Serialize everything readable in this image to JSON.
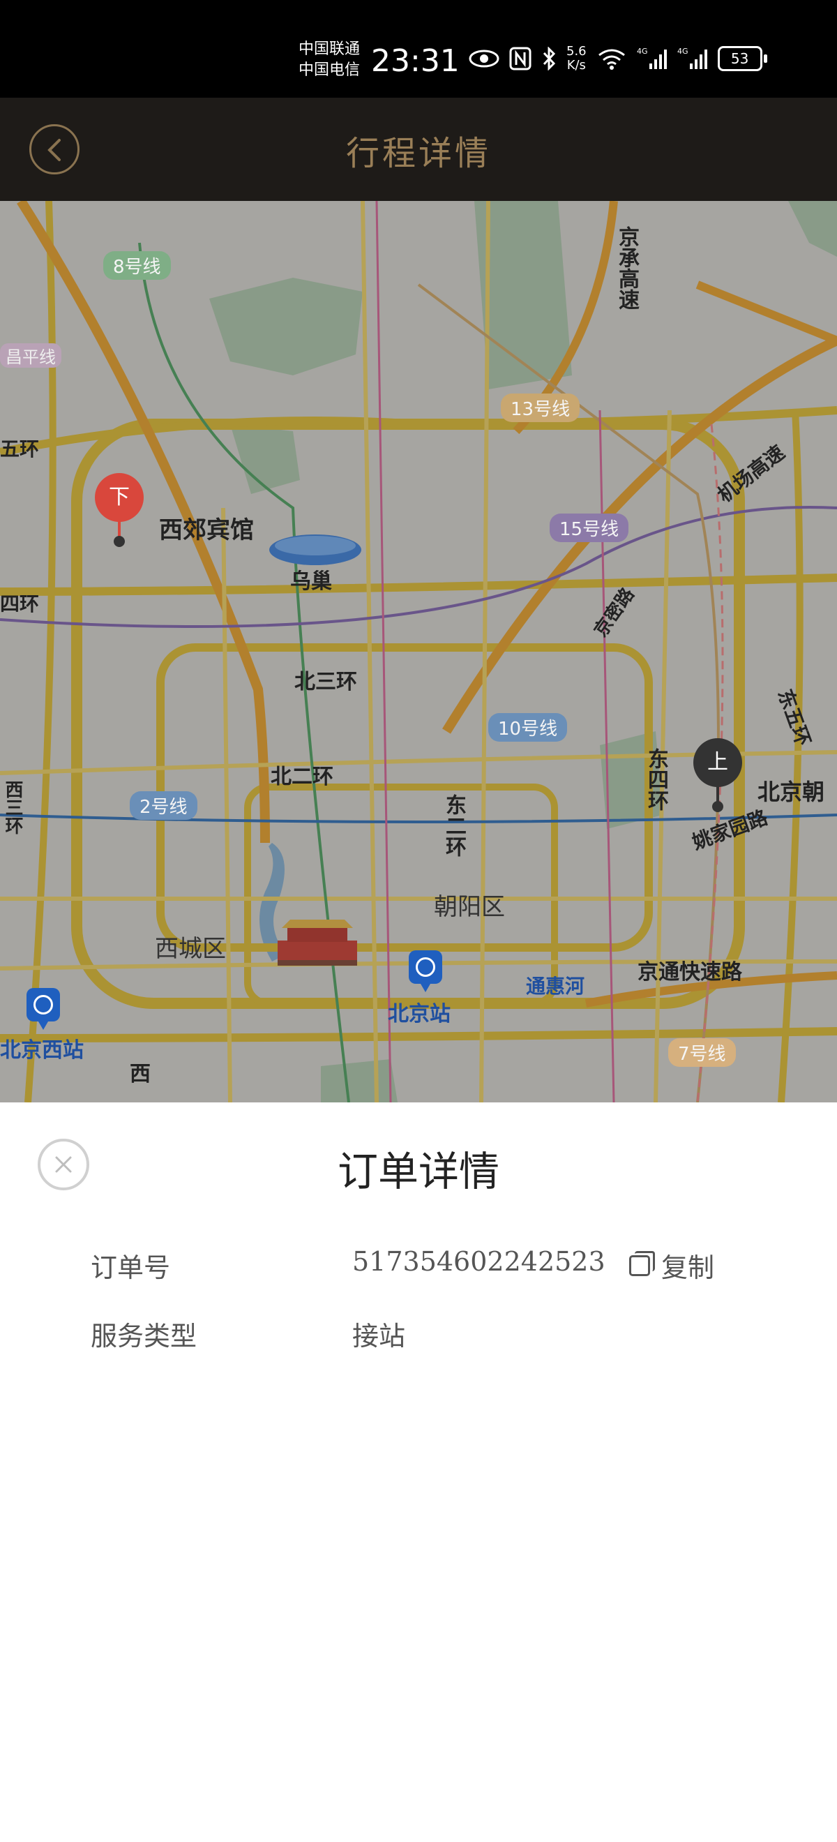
{
  "status_bar": {
    "carrier_1": "中国联通",
    "carrier_2": "中国电信",
    "time": "23:31",
    "net_speed": "5.6",
    "net_speed_unit": "K/s",
    "battery": "53"
  },
  "header": {
    "title": "行程详情"
  },
  "map": {
    "labels": {
      "xijiao": "西郊宾馆",
      "niaochao": "乌巢",
      "bei3": "北三环",
      "bei2": "北二环",
      "xicheng": "西城区",
      "chaoyang": "朝阳区",
      "beijing_station": "北京站",
      "beijingxi_station": "北京西站",
      "tonghui": "通惠河",
      "jingtong": "京通快速路",
      "yaojiayuan": "姚家园路",
      "jichang": "机场高速",
      "beijingchao": "北京朝",
      "changping": "昌平线",
      "wuhuan": "五环",
      "sihuan": "四环",
      "jingcheng": "京承高速",
      "jingmi": "京密路",
      "dong4": "东四环",
      "dong2": "东二环",
      "dong5": "东五环",
      "xi": "西",
      "xi3": "西三环"
    },
    "lines": {
      "l8": "8号线",
      "l13": "13号线",
      "l15": "15号线",
      "l10": "10号线",
      "l2": "2号线",
      "l7": "7号线"
    },
    "markers": {
      "dropoff": "下",
      "pickup": "上"
    }
  },
  "sheet": {
    "title": "订单详情",
    "order_label": "订单号",
    "order_value": "517354602242523",
    "copy_label": "复制",
    "service_label": "服务类型",
    "service_value": "接站"
  },
  "colors": {
    "header_bg": "#1e1b18",
    "header_accent": "#9a7f57",
    "dropoff_marker": "#d9473c",
    "pickup_marker": "#333333",
    "station_blue": "#1f5fbf"
  }
}
